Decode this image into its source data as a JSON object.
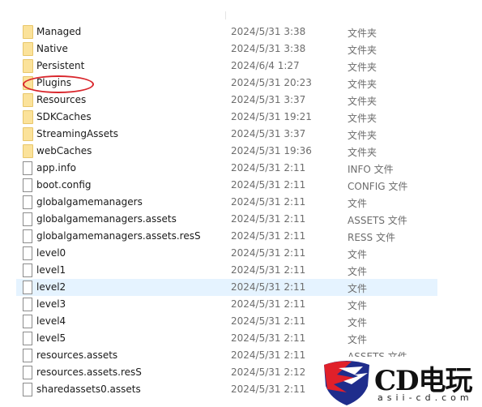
{
  "files": [
    {
      "name": "Managed",
      "date": "2024/5/31 3:38",
      "type": "文件夹",
      "kind": "folder"
    },
    {
      "name": "Native",
      "date": "2024/5/31 3:38",
      "type": "文件夹",
      "kind": "folder"
    },
    {
      "name": "Persistent",
      "date": "2024/6/4 1:27",
      "type": "文件夹",
      "kind": "folder"
    },
    {
      "name": "Plugins",
      "date": "2024/5/31 20:23",
      "type": "文件夹",
      "kind": "folder"
    },
    {
      "name": "Resources",
      "date": "2024/5/31 3:37",
      "type": "文件夹",
      "kind": "folder"
    },
    {
      "name": "SDKCaches",
      "date": "2024/5/31 19:21",
      "type": "文件夹",
      "kind": "folder"
    },
    {
      "name": "StreamingAssets",
      "date": "2024/5/31 3:37",
      "type": "文件夹",
      "kind": "folder"
    },
    {
      "name": "webCaches",
      "date": "2024/5/31 19:36",
      "type": "文件夹",
      "kind": "folder"
    },
    {
      "name": "app.info",
      "date": "2024/5/31 2:11",
      "type": "INFO 文件",
      "kind": "file"
    },
    {
      "name": "boot.config",
      "date": "2024/5/31 2:11",
      "type": "CONFIG 文件",
      "kind": "file"
    },
    {
      "name": "globalgamemanagers",
      "date": "2024/5/31 2:11",
      "type": "文件",
      "kind": "file"
    },
    {
      "name": "globalgamemanagers.assets",
      "date": "2024/5/31 2:11",
      "type": "ASSETS 文件",
      "kind": "file"
    },
    {
      "name": "globalgamemanagers.assets.resS",
      "date": "2024/5/31 2:11",
      "type": "RESS 文件",
      "kind": "file"
    },
    {
      "name": "level0",
      "date": "2024/5/31 2:11",
      "type": "文件",
      "kind": "file"
    },
    {
      "name": "level1",
      "date": "2024/5/31 2:11",
      "type": "文件",
      "kind": "file"
    },
    {
      "name": "level2",
      "date": "2024/5/31 2:11",
      "type": "文件",
      "kind": "file",
      "selected": true
    },
    {
      "name": "level3",
      "date": "2024/5/31 2:11",
      "type": "文件",
      "kind": "file"
    },
    {
      "name": "level4",
      "date": "2024/5/31 2:11",
      "type": "文件",
      "kind": "file"
    },
    {
      "name": "level5",
      "date": "2024/5/31 2:11",
      "type": "文件",
      "kind": "file"
    },
    {
      "name": "resources.assets",
      "date": "2024/5/31 2:11",
      "type": "ASSETS 文件",
      "kind": "file"
    },
    {
      "name": "resources.assets.resS",
      "date": "2024/5/31 2:12",
      "type": "",
      "kind": "file"
    },
    {
      "name": "sharedassets0.assets",
      "date": "2024/5/31 2:11",
      "type": "",
      "kind": "file"
    }
  ],
  "watermark": {
    "brand": "CD电玩",
    "url": "asii-cd.com",
    "colors": {
      "red": "#e0202a",
      "blue": "#1f2d8c"
    }
  },
  "highlight_color": "#e5f3ff"
}
